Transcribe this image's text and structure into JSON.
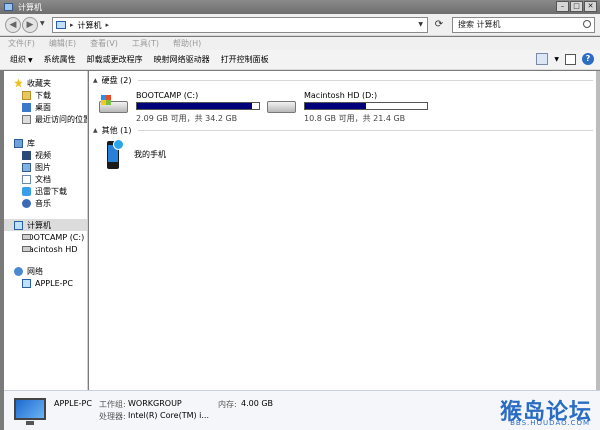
{
  "window": {
    "title": "计算机"
  },
  "address": {
    "segment": "计算机",
    "arrow": "▸"
  },
  "search": {
    "placeholder": "搜索 计算机"
  },
  "menu": [
    "文件(F)",
    "编辑(E)",
    "查看(V)",
    "工具(T)",
    "帮助(H)"
  ],
  "toolbar": {
    "organize": "组织",
    "items": [
      "系统属性",
      "卸载或更改程序",
      "映射网络驱动器",
      "打开控制面板"
    ]
  },
  "nav": {
    "favorites": {
      "label": "收藏夹",
      "items": [
        "下载",
        "桌面",
        "最近访问的位置"
      ]
    },
    "libraries": {
      "label": "库",
      "items": [
        "视频",
        "图片",
        "文档",
        "迅雷下载",
        "音乐"
      ]
    },
    "computer": {
      "label": "计算机",
      "items": [
        "BOOTCAMP (C:)",
        "Macintosh HD"
      ]
    },
    "network": {
      "label": "网络",
      "items": [
        "APPLE-PC"
      ]
    }
  },
  "groups": {
    "harddisks": "硬盘 (2)",
    "other": "其他 (1)"
  },
  "drives": [
    {
      "name": "BOOTCAMP (C:)",
      "size_text": "2.09 GB 可用，共 34.2 GB",
      "used_fraction": 0.94
    },
    {
      "name": "Macintosh HD (D:)",
      "size_text": "10.8 GB 可用，共 21.4 GB",
      "used_fraction": 0.5
    }
  ],
  "other_items": [
    {
      "name": "我的手机"
    }
  ],
  "details": {
    "pc_name": "APPLE-PC",
    "workgroup_label": "工作组:",
    "workgroup": "WORKGROUP",
    "memory_label": "内存:",
    "memory": "4.00 GB",
    "cpu_label": "处理器:",
    "cpu": "Intel(R) Core(TM) i..."
  },
  "watermark": {
    "main": "猴岛论坛",
    "sub": "BBS.HOUDAO.COM"
  },
  "colors": {
    "progress": "#00007a",
    "selection": "#dcdcdc"
  }
}
